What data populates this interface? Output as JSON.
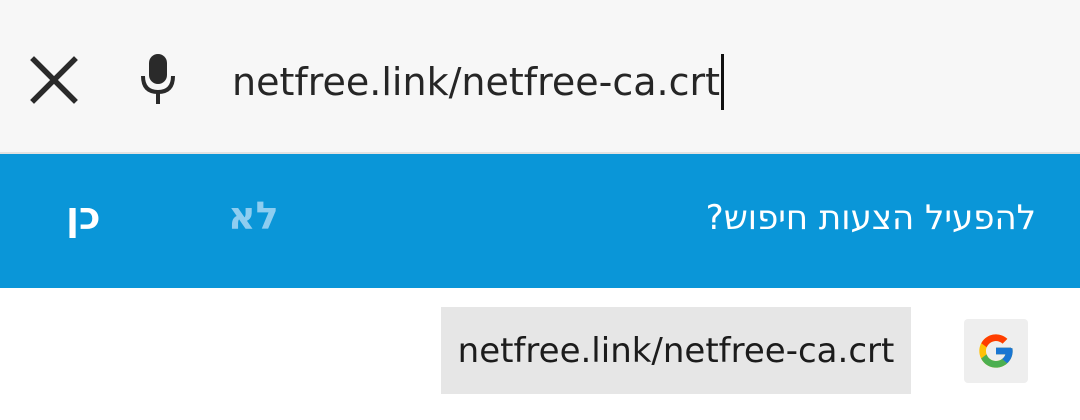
{
  "search": {
    "value": "netfree.link/netfree-ca.crt"
  },
  "banner": {
    "question": "להפעיל הצעות חיפוש?",
    "no_label": "לא",
    "yes_label": "כן",
    "color": "#0a96d8"
  },
  "suggestion": {
    "text": "netfree.link/netfree-ca.crt",
    "icon": "google-icon"
  },
  "icons": {
    "close": "close-icon",
    "mic": "mic-icon"
  }
}
